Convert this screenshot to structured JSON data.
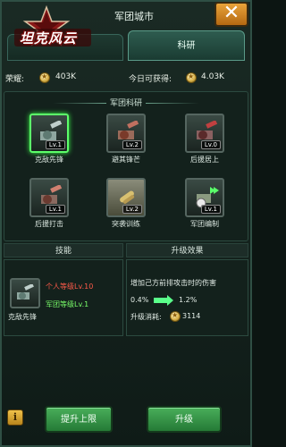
{
  "logo": {
    "text": "坦克风云"
  },
  "window": {
    "title": "军团城市"
  },
  "tabs": [
    {
      "label": ""
    },
    {
      "label": "科研"
    }
  ],
  "honor": {
    "label": "荣耀:",
    "value": "403K",
    "today_label": "今日可获得:",
    "today_value": "4.03K"
  },
  "science": {
    "title": "军团科研",
    "items": [
      {
        "name": "克敌先锋",
        "level": "Lv.1"
      },
      {
        "name": "避其锋芒",
        "level": "Lv.2"
      },
      {
        "name": "后援居上",
        "level": "Lv.0"
      },
      {
        "name": "后援打击",
        "level": "Lv.1"
      },
      {
        "name": "突袭训练",
        "level": "Lv.2"
      },
      {
        "name": "军团编制",
        "level": "Lv.1"
      }
    ]
  },
  "headers": {
    "skill": "技能",
    "effect": "升级效果"
  },
  "skill": {
    "name": "克敌先锋",
    "level": "Lv.1",
    "req_personal": "个人等级Lv.10",
    "req_legion": "军团等级Lv.1"
  },
  "effect": {
    "desc": "增加己方前排攻击时的伤害",
    "from": "0.4%",
    "to": "1.2%",
    "cost_label": "升级消耗:",
    "cost_value": "3114"
  },
  "buttons": {
    "info": "i",
    "raise_limit": "提升上限",
    "upgrade": "升级"
  },
  "close": {
    "label": "✕"
  },
  "colors": {
    "accent_green": "#3cff4a",
    "req_red": "#ff5a4a",
    "req_green": "#7aff6a",
    "button_green": "#49ae5a"
  }
}
